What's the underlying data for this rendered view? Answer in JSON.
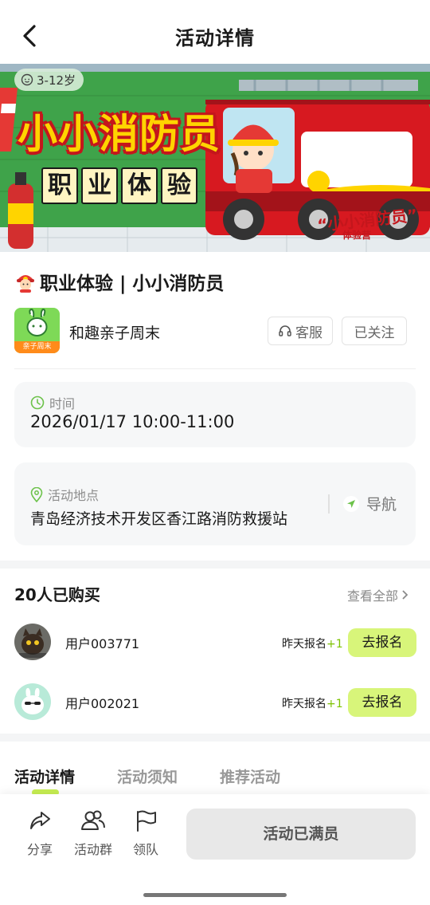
{
  "header": {
    "title": "活动详情"
  },
  "banner": {
    "age_badge": "3-12岁",
    "title": "小小消防员",
    "subtitle_chars": [
      "职",
      "业",
      "体",
      "验"
    ],
    "truck_text": "“小小消防员”",
    "truck_sub": "体验营",
    "colors": {
      "green": "#3fa34a",
      "red": "#c4161c",
      "yellow": "#ffd400"
    }
  },
  "activity": {
    "title": "职业体验 | 小小消防员",
    "title_icon": "firefighter-emoji-icon"
  },
  "organizer": {
    "name": "和趣亲子周末",
    "logo_tag": "亲子周末",
    "service_label": "客服",
    "follow_label": "已关注"
  },
  "time_card": {
    "label": "时间",
    "value": "2026/01/17 10:00-11:00"
  },
  "location_card": {
    "label": "活动地点",
    "value": "青岛经济技术开发区香江路消防救援站",
    "nav_label": "导航"
  },
  "buyers": {
    "title": "20人已购买",
    "view_all": "查看全部",
    "items": [
      {
        "name": "用户003771",
        "note": "昨天报名",
        "plus": "+1",
        "action": "去报名",
        "avatar": "cat-photo"
      },
      {
        "name": "用户002021",
        "note": "昨天报名",
        "plus": "+1",
        "action": "去报名",
        "avatar": "bunny-sunglasses"
      }
    ]
  },
  "tabs": [
    {
      "label": "活动详情",
      "active": true
    },
    {
      "label": "活动须知",
      "active": false
    },
    {
      "label": "推荐活动",
      "active": false
    }
  ],
  "bottom_bar": {
    "share": "分享",
    "group": "活动群",
    "lead": "领队",
    "status_button": "活动已满员"
  },
  "accent_color": "#d8f57a"
}
